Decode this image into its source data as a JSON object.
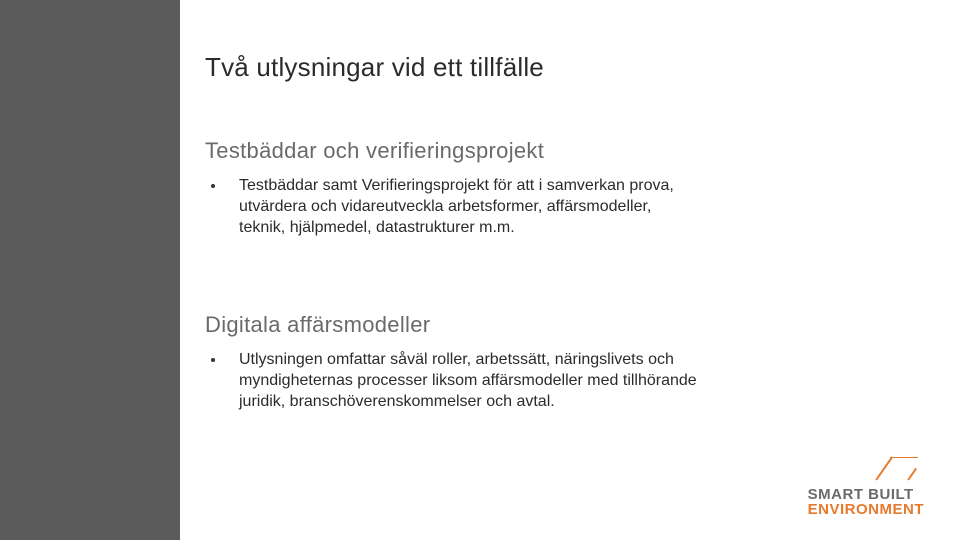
{
  "title": "Två utlysningar vid ett tillfälle",
  "sections": [
    {
      "heading": "Testbäddar och verifieringsprojekt",
      "bullet": "Testbäddar samt Verifieringsprojekt för att i samverkan prova, utvärdera och vidareutveckla arbetsformer, affärsmodeller, teknik, hjälpmedel, datastrukturer m.m."
    },
    {
      "heading": "Digitala affärsmodeller",
      "bullet": "Utlysningen omfattar såväl roller, arbetssätt, näringslivets och myndigheternas processer liksom affärsmodeller med tillhörande juridik, branschöverenskommelser och avtal."
    }
  ],
  "logo": {
    "line1": "SMART BUILT",
    "line2": "ENVIRONMENT"
  },
  "colors": {
    "sidebar": "#5a5a5a",
    "accent": "#e67a2d",
    "heading_grey": "#6a6a6a"
  }
}
